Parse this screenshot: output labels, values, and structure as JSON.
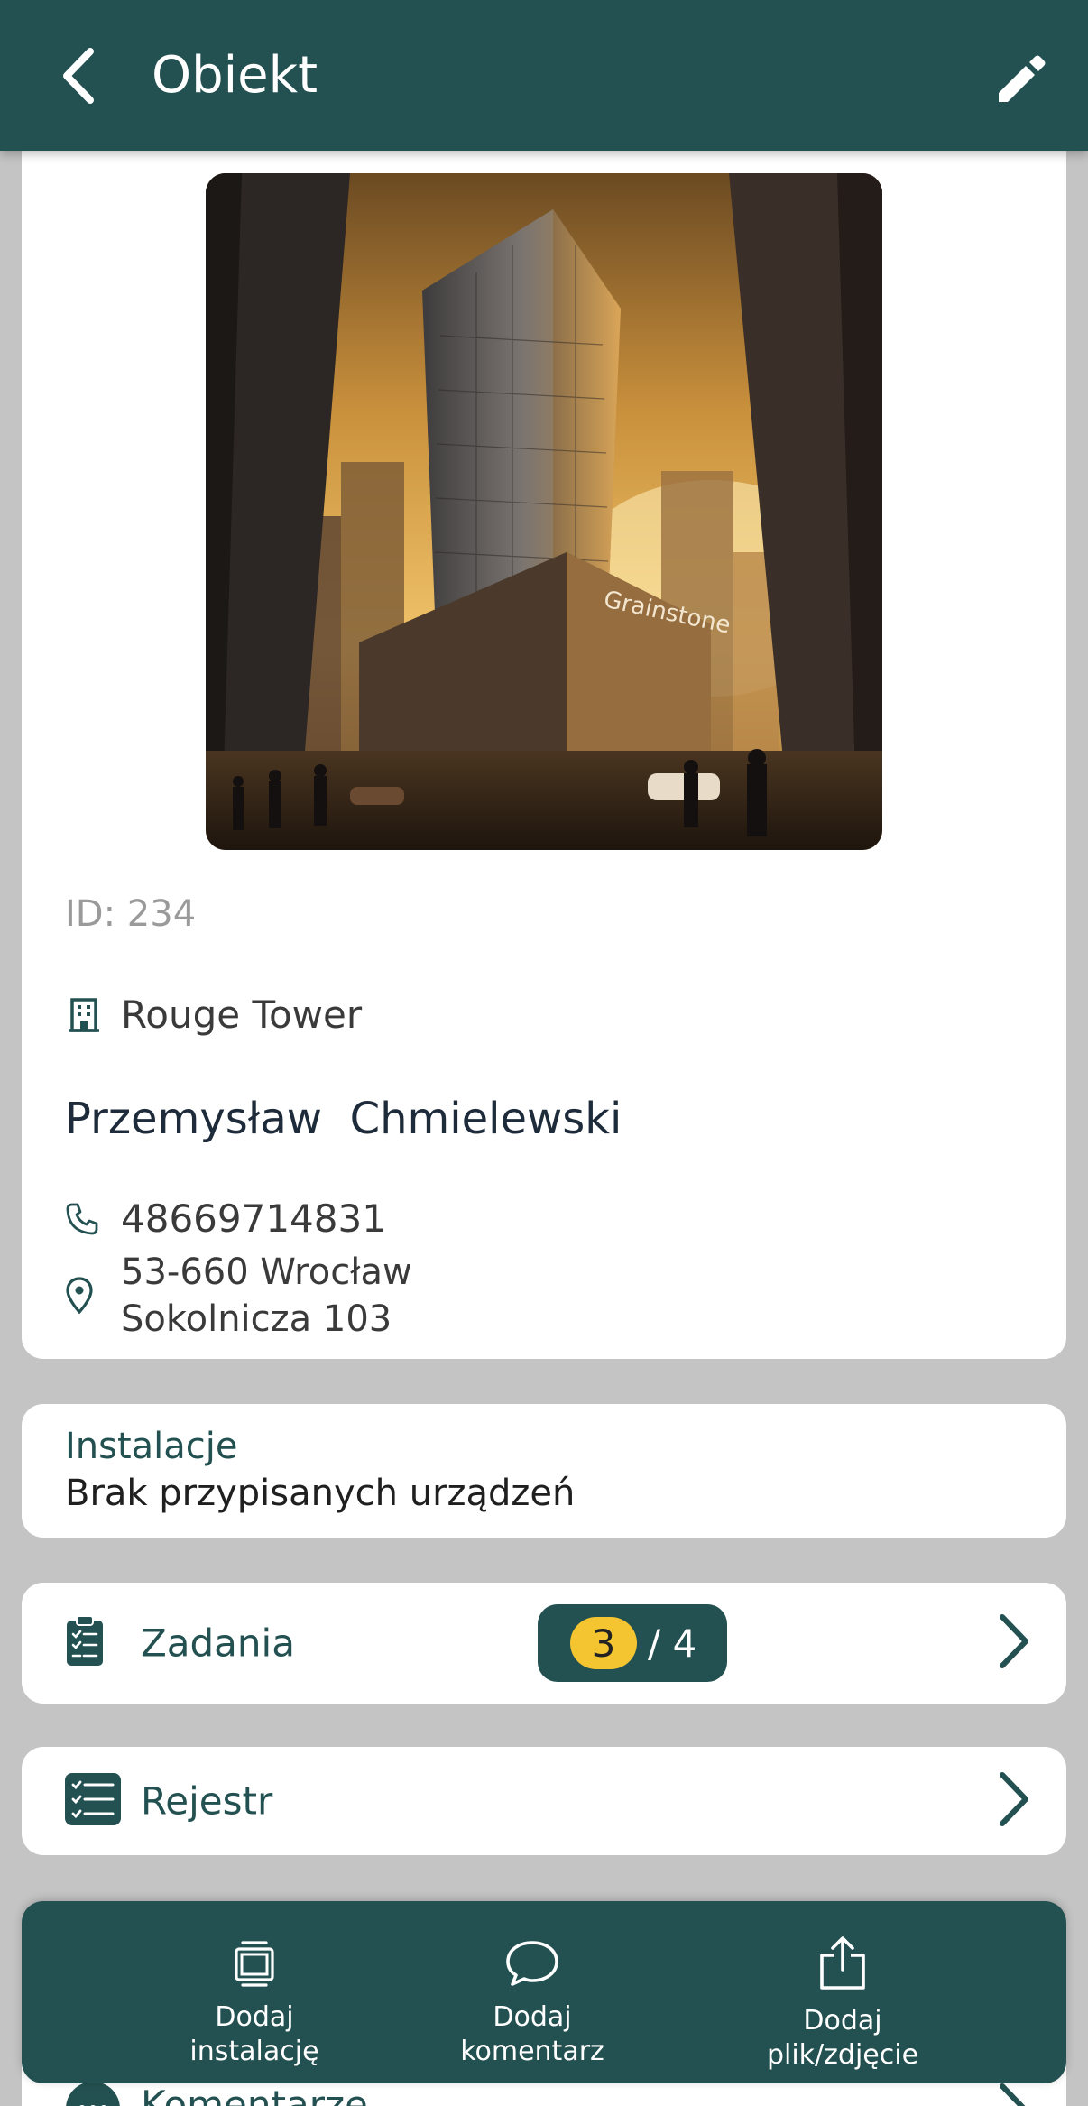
{
  "appbar": {
    "title": "Obiekt"
  },
  "object": {
    "id_text": "ID: 234",
    "building_name": "Rouge Tower",
    "contact_name": "Przemysław  Chmielewski",
    "phone": "48669714831",
    "address_line1": "53-660 Wrocław",
    "address_line2": "Sokolnicza 103"
  },
  "hero_image": {
    "sign_text": "Grainstone"
  },
  "installations": {
    "title": "Instalacje",
    "empty_text": "Brak przypisanych urządzeń"
  },
  "tasks": {
    "label": "Zadania",
    "done": "3",
    "total": "/ 4"
  },
  "register": {
    "label": "Rejestr"
  },
  "comments": {
    "label": "Komentarze"
  },
  "bottom_actions": [
    {
      "label": "Dodaj\ninstalację"
    },
    {
      "label": "Dodaj\nkomentarz"
    },
    {
      "label": "Dodaj\nplik/zdjęcie"
    }
  ],
  "colors": {
    "primary": "#235050",
    "accent": "#f5c531",
    "background": "#c4c4c4"
  }
}
